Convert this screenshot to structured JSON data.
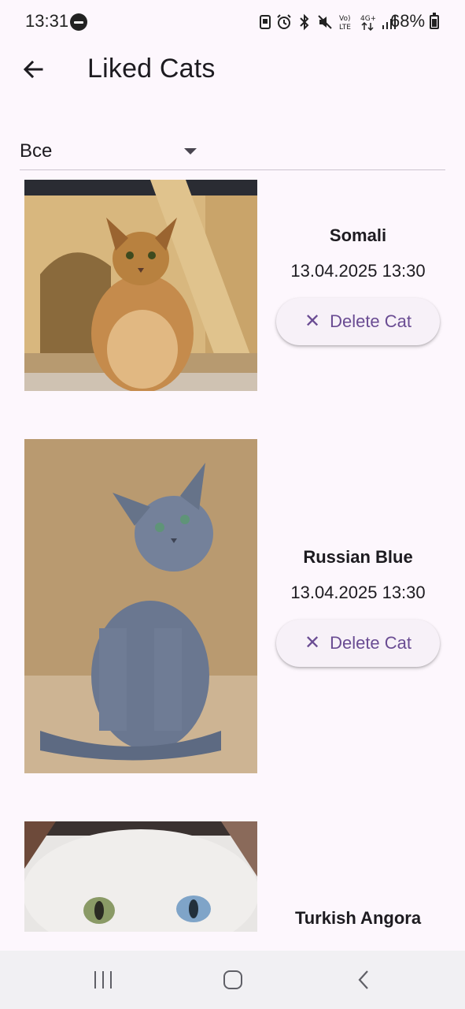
{
  "status_bar": {
    "time": "13:31",
    "battery": "68%",
    "icons": [
      "dnd-icon",
      "notification-icon",
      "alarm-icon",
      "bluetooth-icon",
      "mute-icon",
      "volte-icon",
      "network-4g-icon",
      "signal-icon",
      "battery-icon"
    ]
  },
  "app_bar": {
    "title": "Liked Cats"
  },
  "filter": {
    "value": "Все"
  },
  "cats": [
    {
      "name": "Somali",
      "date": "13.04.2025 13:30",
      "delete_label": "Delete Cat"
    },
    {
      "name": "Russian Blue",
      "date": "13.04.2025 13:30",
      "delete_label": "Delete Cat"
    },
    {
      "name": "Turkish Angora"
    }
  ],
  "colors": {
    "background": "#fdf7fd",
    "accent": "#6a4c93",
    "button_surface": "#f7f1f8",
    "nav_bar": "#f1f0f3"
  }
}
